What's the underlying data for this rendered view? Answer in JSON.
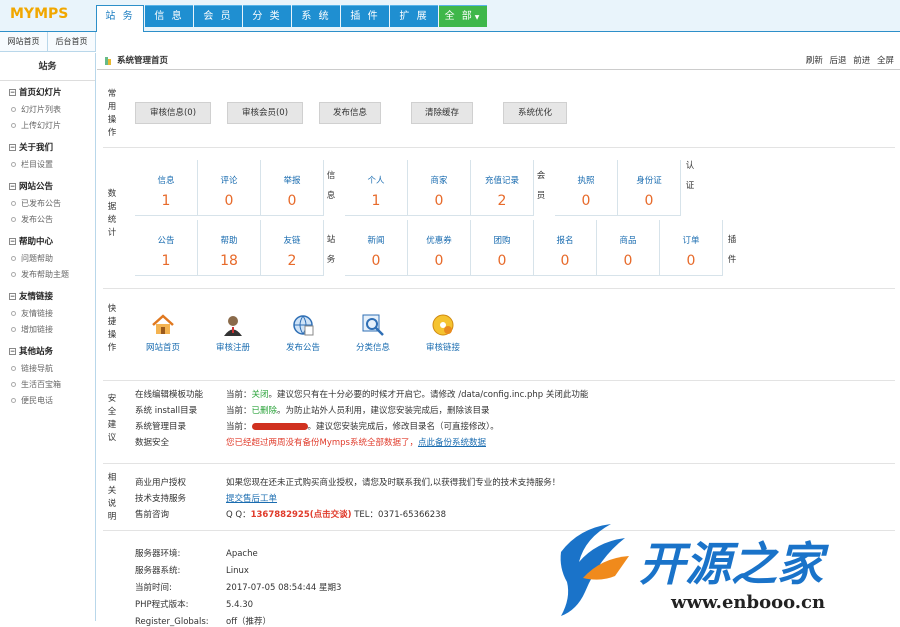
{
  "logo": "MYMPS",
  "nav": {
    "tabs": [
      "站 务",
      "信 息",
      "会 员",
      "分 类",
      "系 统",
      "插 件",
      "扩 展",
      "全 部"
    ]
  },
  "subtabs": [
    "网站首页",
    "后台首页"
  ],
  "sidebar": {
    "title": "站务",
    "groups": [
      {
        "title": "首页幻灯片",
        "items": [
          "幻灯片列表",
          "上传幻灯片"
        ]
      },
      {
        "title": "关于我们",
        "items": [
          "栏目设置"
        ]
      },
      {
        "title": "网站公告",
        "items": [
          "已发布公告",
          "发布公告"
        ]
      },
      {
        "title": "帮助中心",
        "items": [
          "问题帮助",
          "发布帮助主题"
        ]
      },
      {
        "title": "友情链接",
        "items": [
          "友情链接",
          "增加链接"
        ]
      },
      {
        "title": "其他站务",
        "items": [
          "链接导航",
          "生活百宝箱",
          "便民电话"
        ]
      }
    ]
  },
  "crumb": {
    "title": "系统管理首页",
    "links": [
      "刷新",
      "后退",
      "前进",
      "全屏"
    ]
  },
  "sections": {
    "common": {
      "label": "常用操作",
      "buttons": [
        "审核信息(0)",
        "审核会员(0)",
        "发布信息",
        "清除缓存",
        "系统优化"
      ]
    },
    "stats": {
      "label": "数据统计",
      "groups": [
        "信息",
        "会员",
        "认证",
        "站务",
        "插件"
      ],
      "row1": [
        {
          "label": "信息",
          "value": "1"
        },
        {
          "label": "评论",
          "value": "0"
        },
        {
          "label": "举报",
          "value": "0"
        },
        {
          "label": "个人",
          "value": "1"
        },
        {
          "label": "商家",
          "value": "0"
        },
        {
          "label": "充值记录",
          "value": "2"
        },
        {
          "label": "执照",
          "value": "0"
        },
        {
          "label": "身份证",
          "value": "0"
        }
      ],
      "row2": [
        {
          "label": "公告",
          "value": "1"
        },
        {
          "label": "帮助",
          "value": "18"
        },
        {
          "label": "友链",
          "value": "2"
        },
        {
          "label": "新闻",
          "value": "0"
        },
        {
          "label": "优惠券",
          "value": "0"
        },
        {
          "label": "团购",
          "value": "0"
        },
        {
          "label": "报名",
          "value": "0"
        },
        {
          "label": "商品",
          "value": "0"
        },
        {
          "label": "订单",
          "value": "0"
        }
      ]
    },
    "quick": {
      "label": "快捷操作",
      "items": [
        "网站首页",
        "审核注册",
        "发布公告",
        "分类信息",
        "审核链接"
      ]
    },
    "security": {
      "label": "安全建议",
      "rows": [
        {
          "name": "在线编辑模板功能",
          "prefix": "当前：",
          "state": "关闭",
          "text": "。建议您只有在十分必要的时候才开启它。请修改 /data/config.inc.php 关闭此功能"
        },
        {
          "name": "系统 install目录",
          "prefix": "当前：",
          "state": "已删除",
          "text": "。为防止站外人员利用，建议您安装完成后，删除该目录"
        },
        {
          "name": "系统管理目录",
          "prefix": "当前：",
          "state": "",
          "text": "。建议您安装完成后，修改目录名（可直接修改）。"
        },
        {
          "name": "数据安全",
          "prefix": "",
          "state": "",
          "text": "您已经超过两周没有备份Mymps系统全部数据了，",
          "link": "点此备份系统数据"
        }
      ]
    },
    "about": {
      "label": "相关说明",
      "rows": [
        {
          "name": "商业用户授权",
          "text": "如果您现在还未正式购买商业授权，请您及时联系我们,以获得我们专业的技术支持服务！"
        },
        {
          "name": "技术支持服务",
          "link": "提交售后工单"
        },
        {
          "name": "售前咨询",
          "qq_label": "Q Q：",
          "qq": "1367882925(点击交谈)",
          "tel": " TEL：0371-65366238"
        }
      ]
    },
    "server": {
      "rows": [
        {
          "name": "服务器环境:",
          "value": "Apache"
        },
        {
          "name": "服务器系统:",
          "value": "Linux"
        },
        {
          "name": "当前时间:",
          "value": "2017-07-05 08:54:44 星期3"
        },
        {
          "name": "PHP程式版本:",
          "value": "5.4.30"
        },
        {
          "name": "Register_Globals:",
          "value": "off（推荐）"
        }
      ]
    }
  },
  "watermark": {
    "title": "开源之家",
    "url": "www.enbooo.cn"
  },
  "colors": {
    "nav": "#1f8fd1",
    "accent": "#e76a2a",
    "link": "#1a6cb0",
    "watermark": "#1a73c9"
  }
}
